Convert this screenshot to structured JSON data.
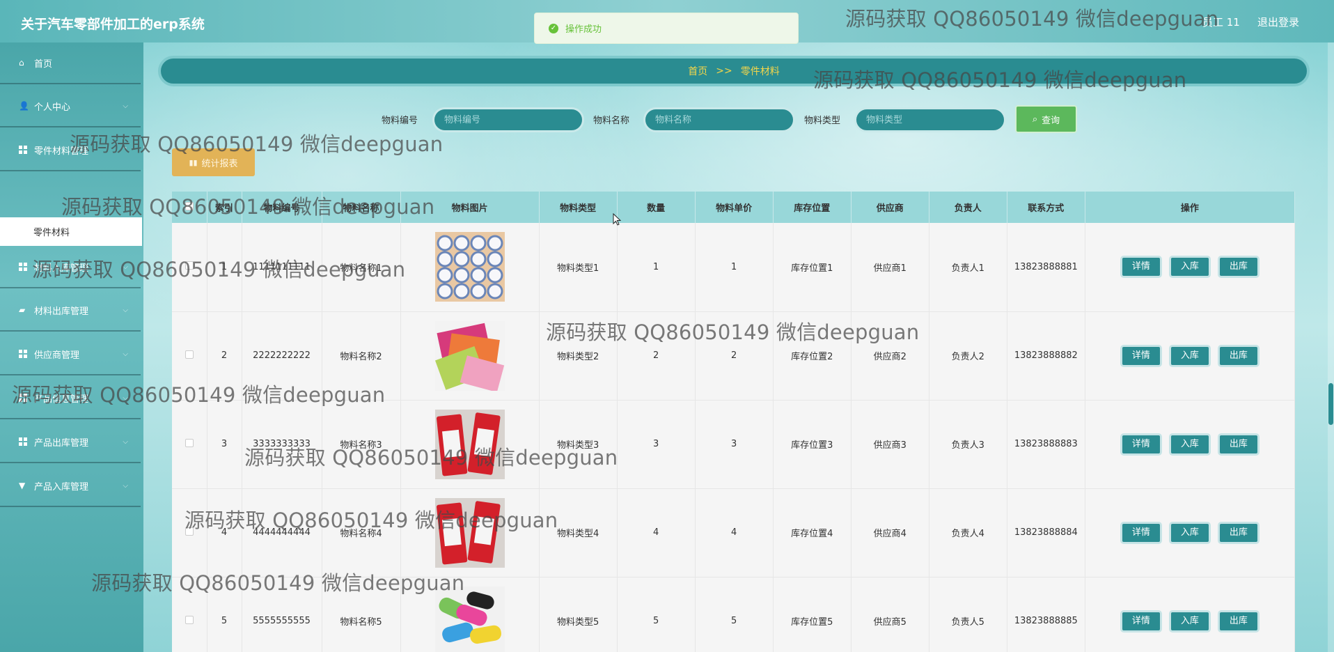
{
  "app": {
    "title": "关于汽车零部件加工的erp系统"
  },
  "header": {
    "user": "员工 11",
    "logout": "退出登录"
  },
  "toast": {
    "message": "操作成功"
  },
  "sidebar": {
    "items": [
      {
        "label": "首页",
        "icon": "home-icon"
      },
      {
        "label": "个人中心",
        "icon": "user-icon"
      },
      {
        "label": "零件材料管理",
        "icon": "grid-icon"
      },
      {
        "label": "材料入库管理",
        "icon": "grid-icon"
      },
      {
        "label": "材料出库管理",
        "icon": "bag-icon"
      },
      {
        "label": "供应商管理",
        "icon": "grid-icon"
      },
      {
        "label": "产品信息管理",
        "icon": "grid-icon"
      },
      {
        "label": "产品出库管理",
        "icon": "grid-icon"
      },
      {
        "label": "产品入库管理",
        "icon": "cup-icon"
      }
    ],
    "sub_item": "零件材料"
  },
  "breadcrumb": {
    "home": "首页",
    "sep": ">>",
    "current": "零件材料"
  },
  "search": {
    "code_label": "物料编号",
    "code_placeholder": "物料编号",
    "name_label": "物料名称",
    "name_placeholder": "物料名称",
    "type_label": "物料类型",
    "type_placeholder": "物料类型",
    "button": "查询"
  },
  "stats_button": "统计报表",
  "table": {
    "headers": [
      "",
      "索引",
      "物料编号",
      "物料名称",
      "物料图片",
      "物料类型",
      "数量",
      "物料单价",
      "库存位置",
      "供应商",
      "负责人",
      "联系方式",
      "操作"
    ],
    "rows": [
      {
        "index": "1",
        "code": "1111111111",
        "name": "物料名称1",
        "type": "物料类型1",
        "qty": "1",
        "price": "1",
        "location": "库存位置1",
        "supplier": "供应商1",
        "owner": "负责人1",
        "phone": "13823888881",
        "image": "tissue-rolls"
      },
      {
        "index": "2",
        "code": "2222222222",
        "name": "物料名称2",
        "type": "物料类型2",
        "qty": "2",
        "price": "2",
        "location": "库存位置2",
        "supplier": "供应商2",
        "owner": "负责人2",
        "phone": "13823888882",
        "image": "cleaning-cloths"
      },
      {
        "index": "3",
        "code": "3333333333",
        "name": "物料名称3",
        "type": "物料类型3",
        "qty": "3",
        "price": "3",
        "location": "库存位置3",
        "supplier": "供应商3",
        "owner": "负责人3",
        "phone": "13823888883",
        "image": "toothpaste"
      },
      {
        "index": "4",
        "code": "4444444444",
        "name": "物料名称4",
        "type": "物料类型4",
        "qty": "4",
        "price": "4",
        "location": "库存位置4",
        "supplier": "供应商4",
        "owner": "负责人4",
        "phone": "13823888884",
        "image": "toothpaste"
      },
      {
        "index": "5",
        "code": "5555555555",
        "name": "物料名称5",
        "type": "物料类型5",
        "qty": "5",
        "price": "5",
        "location": "库存位置5",
        "supplier": "供应商5",
        "owner": "负责人5",
        "phone": "13823888885",
        "image": "trash-bags"
      }
    ],
    "actions": {
      "detail": "详情",
      "in": "入库",
      "out": "出库"
    }
  },
  "watermark": "源码获取 QQ86050149 微信deepguan",
  "colors": {
    "primary": "#2a8c91",
    "accent": "#f4d64a",
    "success": "#5cb85c",
    "warning": "#e2b357"
  }
}
